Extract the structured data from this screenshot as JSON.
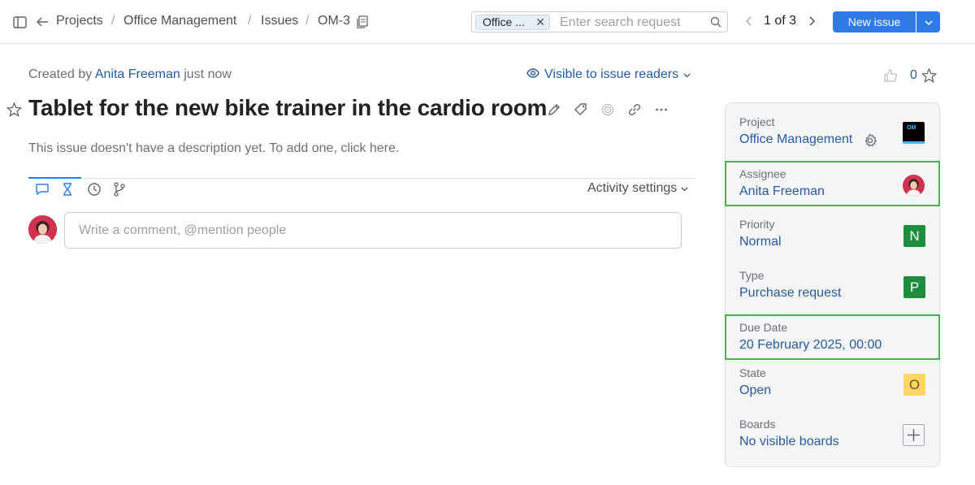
{
  "breadcrumb": {
    "items": [
      "Projects",
      "Office Management",
      "Issues",
      "OM-3"
    ],
    "separator": "/"
  },
  "search": {
    "chip_label": "Office ...",
    "placeholder": "Enter search request"
  },
  "pager": {
    "text": "1 of 3"
  },
  "toolbar": {
    "new_issue_label": "New issue"
  },
  "issue": {
    "created_prefix": "Created by",
    "author": "Anita Freeman",
    "created_when": "just now",
    "visibility": "Visible to issue readers",
    "title": "Tablet for the new bike trainer in the cardio room",
    "description_placeholder": "This issue doesn't have a description yet. To add one, click here.",
    "votes": "0"
  },
  "activity": {
    "settings_label": "Activity settings",
    "comment_placeholder": "Write a comment, @mention people"
  },
  "fields": {
    "project": {
      "label": "Project",
      "value": "Office Management",
      "logo_text": "OM"
    },
    "assignee": {
      "label": "Assignee",
      "value": "Anita Freeman"
    },
    "priority": {
      "label": "Priority",
      "value": "Normal",
      "badge": "N",
      "badge_color": "#1e8e3e"
    },
    "type": {
      "label": "Type",
      "value": "Purchase request",
      "badge": "P",
      "badge_color": "#1e8e3e"
    },
    "due_date": {
      "label": "Due Date",
      "value": "20 February 2025, 00:00"
    },
    "state": {
      "label": "State",
      "value": "Open",
      "badge": "O",
      "badge_color": "#ffd666"
    },
    "boards": {
      "label": "Boards",
      "value": "No visible boards"
    }
  },
  "colors": {
    "accent": "#2f7be6",
    "link": "#2a5aa0",
    "highlight": "#4caf50"
  }
}
